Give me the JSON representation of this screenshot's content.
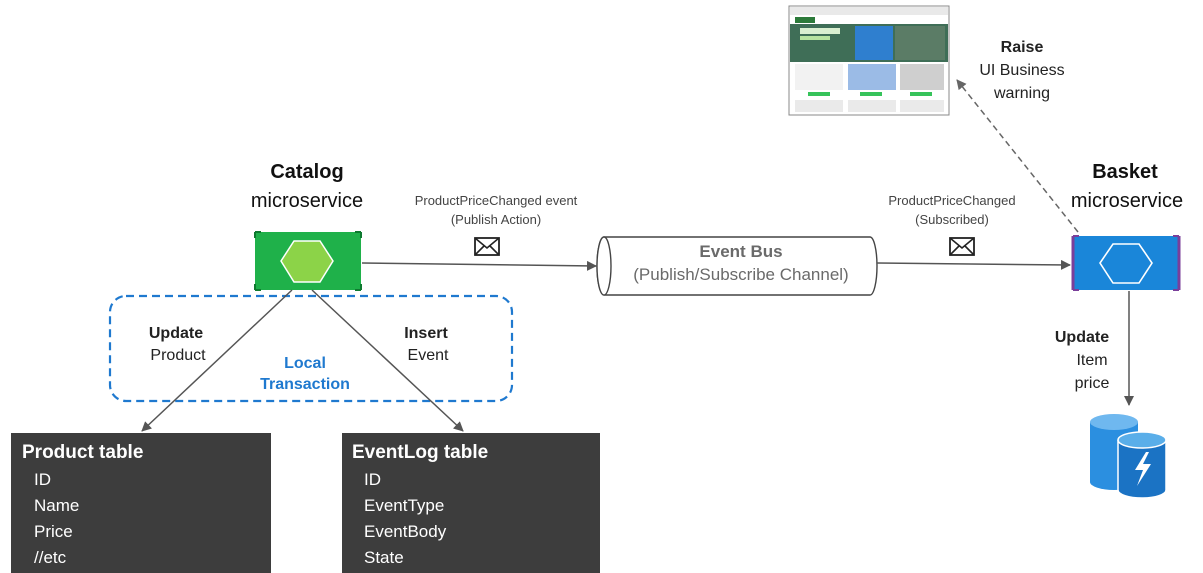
{
  "catalog": {
    "title": "Catalog",
    "subtitle": "microservice"
  },
  "basket": {
    "title": "Basket",
    "subtitle": "microservice"
  },
  "publish_label": {
    "line1": "ProductPriceChanged event",
    "line2": "(Publish Action)"
  },
  "subscribe_label": {
    "line1": "ProductPriceChanged",
    "line2": "(Subscribed)"
  },
  "event_bus": {
    "title": "Event Bus",
    "subtitle": "(Publish/Subscribe Channel)"
  },
  "update_product": {
    "title": "Update",
    "detail": "Product"
  },
  "insert_event": {
    "title": "Insert",
    "detail": "Event"
  },
  "local_transaction": {
    "line1": "Local",
    "line2": "Transaction"
  },
  "update_item_price": {
    "title": "Update",
    "line1": "Item",
    "line2": "price"
  },
  "raise_warning": {
    "title": "Raise",
    "line1": "UI Business",
    "line2": "warning"
  },
  "product_table": {
    "title": "Product table",
    "fields": [
      "ID",
      "Name",
      "Price",
      "//etc"
    ]
  },
  "eventlog_table": {
    "title": "EventLog table",
    "fields": [
      "ID",
      "EventType",
      "EventBody",
      "State"
    ]
  },
  "colors": {
    "catalog_green": "#1fb14a",
    "hexagon_green": "#8cd348",
    "basket_blue": "#1a86d9",
    "basket_border": "#7a3f9a",
    "local_tx_blue": "#1f79cf",
    "table_bg": "#3d3d3d",
    "db_blue": "#2b8fe0"
  },
  "icons": [
    "envelope-icon",
    "hexagon-icon",
    "database-icon",
    "website-thumbnail"
  ]
}
